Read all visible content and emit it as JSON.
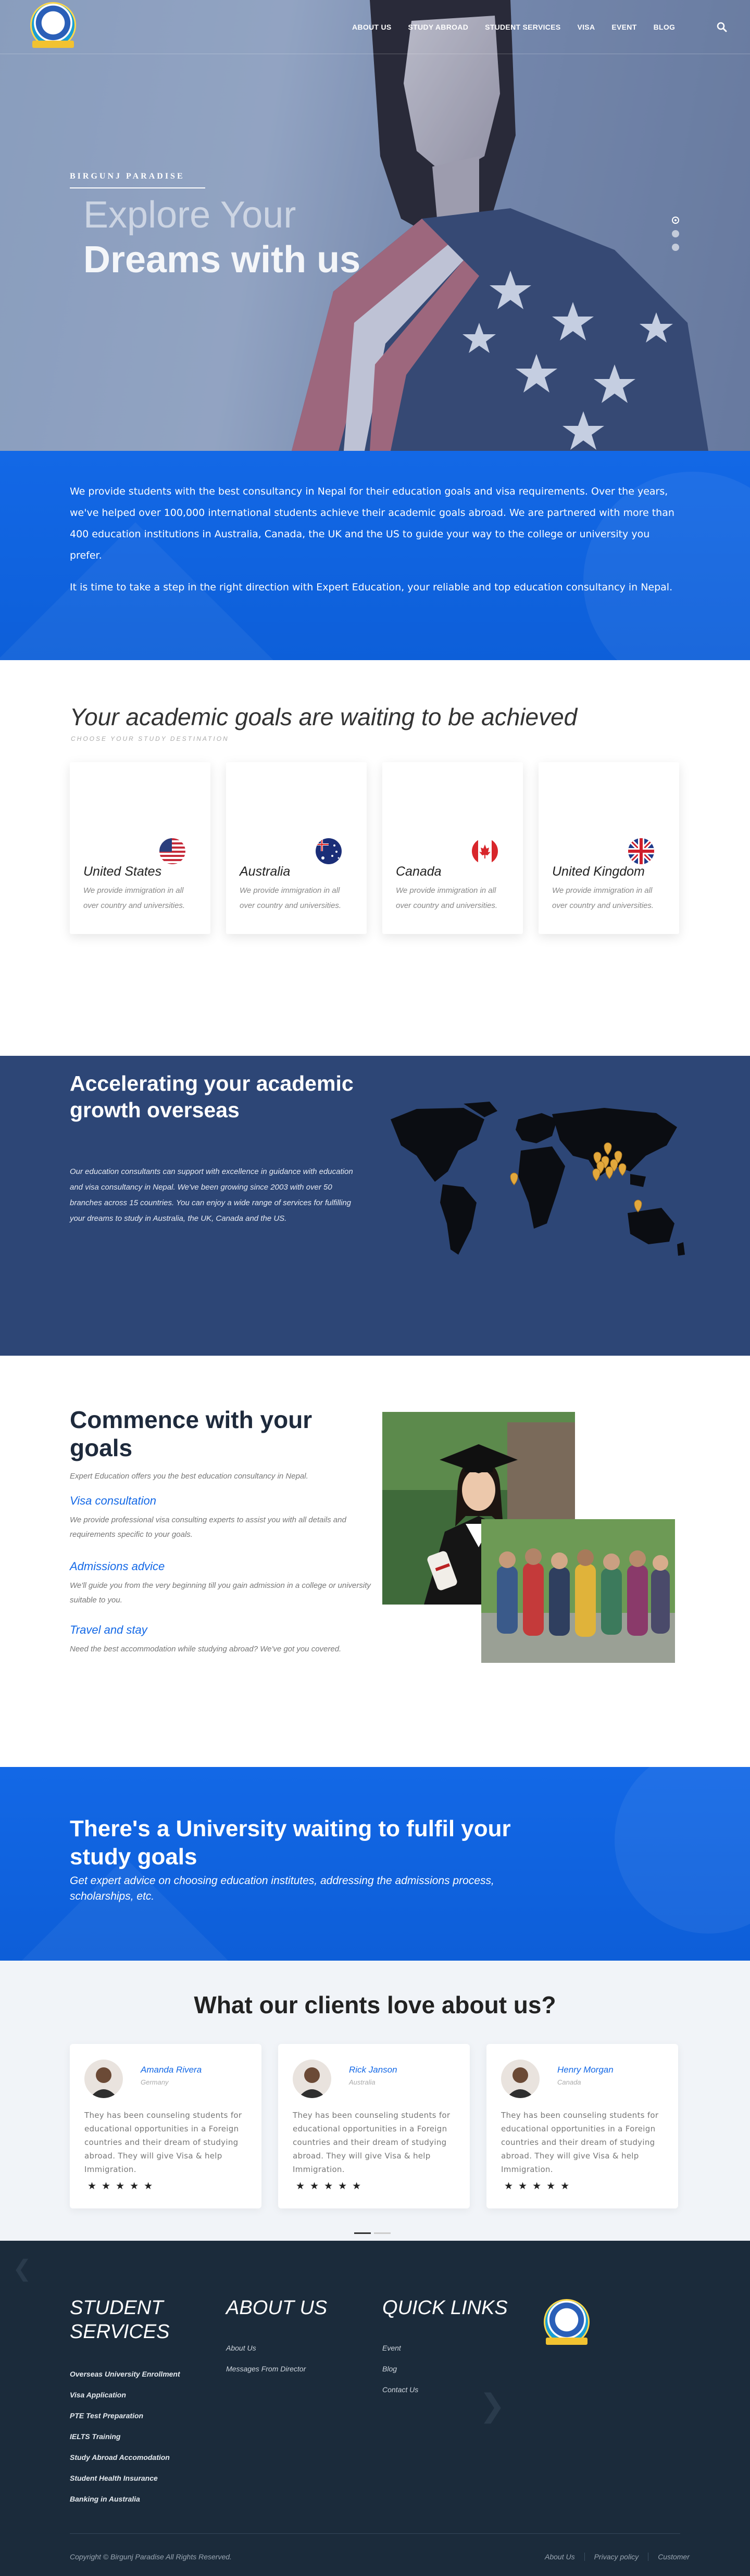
{
  "nav": {
    "items": [
      "ABOUT US",
      "STUDY ABROAD",
      "STUDENT SERVICES",
      "VISA",
      "EVENT",
      "BLOG"
    ]
  },
  "hero": {
    "subtitle": "BIRGUNJ PARADISE",
    "title_line1": "Explore Your",
    "title_line2": "Dreams with us",
    "slides": 3
  },
  "intro": {
    "p1": "We provide students with the best consultancy in Nepal for their education goals and visa requirements. Over the years, we've helped over 100,000 international students achieve their academic goals abroad. We are partnered with more than 400 education institutions in Australia, Canada, the UK and the US to guide your way to the college or university you prefer.",
    "p2": "It is time to take a step in the right direction with Expert Education, your reliable and top education consultancy in Nepal."
  },
  "goals": {
    "title": "Your academic goals are waiting to be achieved",
    "subtitle": "CHOOSE YOUR STUDY DESTINATION",
    "cards": [
      {
        "country": "United States",
        "text": "We provide immigration in all over country and universities."
      },
      {
        "country": "Australia",
        "text": "We provide immigration in all over country and universities."
      },
      {
        "country": "Canada",
        "text": "We provide immigration in all over country and universities."
      },
      {
        "country": "United Kingdom",
        "text": "We provide immigration in all over country and universities."
      }
    ]
  },
  "accelerating": {
    "title": "Accelerating your academic growth overseas",
    "text": "Our education consultants can support with excellence in guidance with education and visa consultancy in Nepal. We've been growing since 2003 with over 50 branches across 15 countries. You can enjoy a wide range of services for fulfilling your dreams to study in Australia, the UK, Canada and the US."
  },
  "commence": {
    "title": "Commence with your goals",
    "lead": "Expert Education offers you the best education consultancy in Nepal.",
    "items": [
      {
        "title": "Visa consultation",
        "text": "We provide professional visa consulting experts to assist you with all details and requirements specific to your goals."
      },
      {
        "title": "Admissions advice",
        "text": "We'll guide you from the very beginning till you gain admission in a college or university suitable to you."
      },
      {
        "title": "Travel and stay",
        "text": "Need the best accommodation while studying abroad? We've got you covered."
      }
    ]
  },
  "cta": {
    "title": "There's a University waiting to fulfil your study goals",
    "text": "Get expert advice on choosing education institutes, addressing the admissions process, scholarships, etc."
  },
  "testimonials": {
    "title": "What our clients love about us?",
    "items": [
      {
        "name": "Amanda Rivera",
        "country": "Germany",
        "quote": "They has been counseling students for educational opportunities in a Foreign countries and their dream of studying abroad. They will give Visa & help Immigration.",
        "stars": "★★★★★"
      },
      {
        "name": "Rick Janson",
        "country": "Australia",
        "quote": "They has been counseling students for educational opportunities in a Foreign countries and their dream of studying abroad. They will give Visa & help Immigration.",
        "stars": "★★★★★"
      },
      {
        "name": "Henry Morgan",
        "country": "Canada",
        "quote": "They has been counseling students for educational opportunities in a Foreign countries and their dream of studying abroad. They will give Visa & help Immigration.",
        "stars": "★★★★★"
      }
    ]
  },
  "footer": {
    "col1_title": "STUDENT SERVICES",
    "col1_links": [
      "Overseas University Enrollment",
      "Visa Application",
      "PTE Test Preparation",
      "IELTS Training",
      "Study Abroad Accomodation",
      "Student Health Insurance",
      "Banking in Australia"
    ],
    "col2_title": "ABOUT US",
    "col2_links": [
      "About Us",
      "Messages From Director"
    ],
    "col3_title": "QUICK LINKS",
    "col3_links": [
      "Event",
      "Blog",
      "Contact Us"
    ],
    "copyright": "Copyright © Birgunj Paradise All Rights Reserved.",
    "bottom_links": [
      "About Us",
      "Privacy policy",
      "Customer"
    ]
  }
}
